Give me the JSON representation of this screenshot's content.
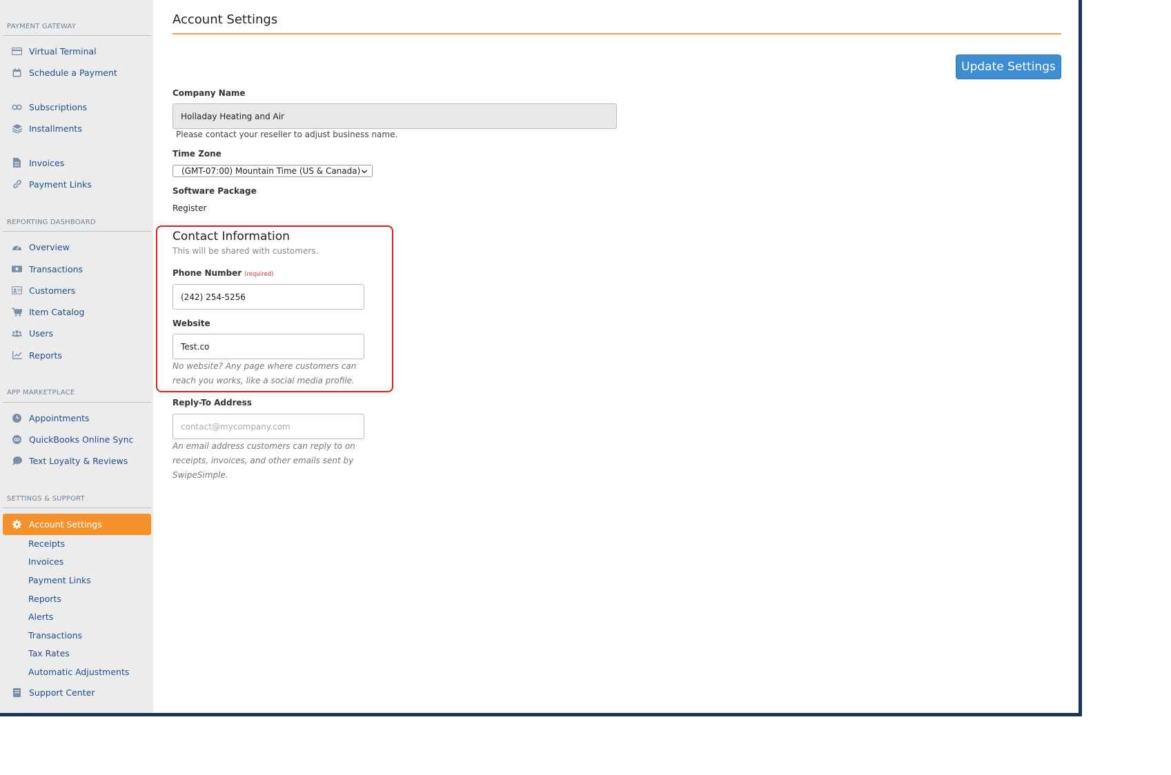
{
  "sidebar": {
    "sections": {
      "payment_gateway": "PAYMENT GATEWAY",
      "reporting_dashboard": "REPORTING DASHBOARD",
      "app_marketplace": "APP MARKETPLACE",
      "settings_support": "SETTINGS & SUPPORT"
    },
    "items": {
      "virtual_terminal": "Virtual Terminal",
      "schedule_payment": "Schedule a Payment",
      "subscriptions": "Subscriptions",
      "installments": "Installments",
      "invoices": "Invoices",
      "payment_links": "Payment Links",
      "overview": "Overview",
      "transactions": "Transactions",
      "customers": "Customers",
      "item_catalog": "Item Catalog",
      "users": "Users",
      "reports": "Reports",
      "appointments": "Appointments",
      "quickbooks": "QuickBooks Online Sync",
      "text_loyalty": "Text Loyalty & Reviews",
      "account_settings": "Account Settings",
      "support_center": "Support Center"
    },
    "subitems": {
      "receipts": "Receipts",
      "invoices": "Invoices",
      "payment_links": "Payment Links",
      "reports": "Reports",
      "alerts": "Alerts",
      "transactions": "Transactions",
      "tax_rates": "Tax Rates",
      "automatic_adjustments": "Automatic Adjustments"
    }
  },
  "main": {
    "title": "Account Settings",
    "update_button": "Update Settings",
    "company_name": {
      "label": "Company Name",
      "value": "Holladay Heating and Air",
      "help": "Please contact your reseller to adjust business name."
    },
    "time_zone": {
      "label": "Time Zone",
      "value": "(GMT-07:00) Mountain Time (US & Canada)"
    },
    "software_package": {
      "label": "Software Package",
      "value": "Register"
    },
    "contact": {
      "heading": "Contact Information",
      "subheading": "This will be shared with customers.",
      "phone_label": "Phone Number",
      "required": "(required)",
      "phone_value": "(242) 254-5256",
      "website_label": "Website",
      "website_value": "Test.co",
      "website_help_1": "No website? Any page where customers can",
      "website_help_2": "reach you works, like a social media profile."
    },
    "reply_to": {
      "label": "Reply-To Address",
      "placeholder": "contact@mycompany.com",
      "help_1": "An email address customers can reply to on",
      "help_2": "receipts, invoices, and other emails sent by",
      "help_3": "SwipeSimple."
    }
  },
  "colors": {
    "accent_orange": "#f5922e",
    "primary_blue": "#3c8dd1",
    "link_blue": "#1e4f8a",
    "highlight_red": "#e21c1c"
  }
}
